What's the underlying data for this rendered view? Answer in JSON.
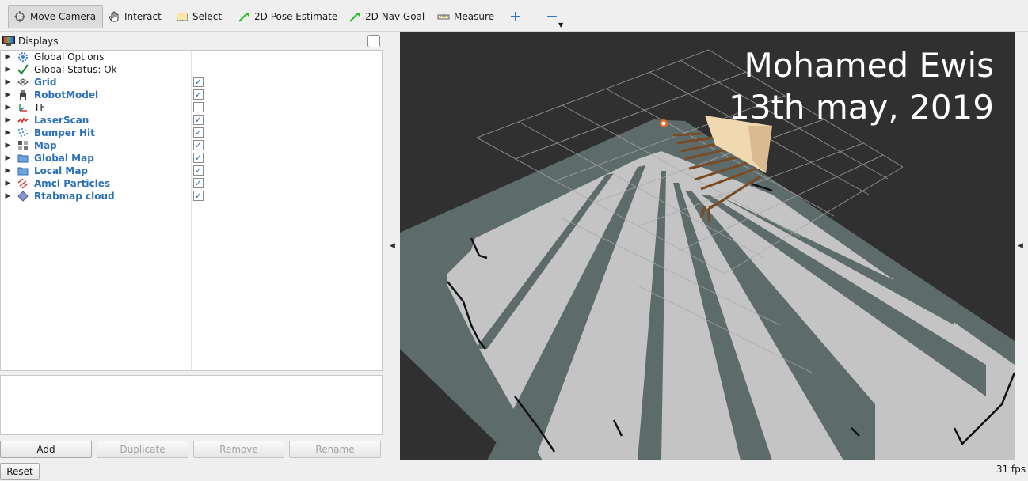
{
  "toolbar": {
    "tools": [
      {
        "label": "Move Camera",
        "icon": "move-camera-icon",
        "active": true
      },
      {
        "label": "Interact",
        "icon": "hand-icon"
      },
      {
        "label": "Select",
        "icon": "select-box-icon"
      },
      {
        "label": "2D Pose Estimate",
        "icon": "green-arrow-icon"
      },
      {
        "label": "2D Nav Goal",
        "icon": "green-arrow-icon"
      },
      {
        "label": "Measure",
        "icon": "ruler-icon"
      }
    ]
  },
  "displays_panel": {
    "title": "Displays",
    "items": [
      {
        "label": "Global Options",
        "icon": "gear-icon",
        "enabled": null
      },
      {
        "label": "Global Status: Ok",
        "icon": "checkmark-icon",
        "enabled": null
      },
      {
        "label": "Grid",
        "icon": "grid-icon",
        "enabled": true
      },
      {
        "label": "RobotModel",
        "icon": "robot-icon",
        "enabled": true
      },
      {
        "label": "TF",
        "icon": "axes-icon",
        "enabled": false
      },
      {
        "label": "LaserScan",
        "icon": "laser-scan-icon",
        "enabled": true
      },
      {
        "label": "Bumper Hit",
        "icon": "point-cloud-icon",
        "enabled": true
      },
      {
        "label": "Map",
        "icon": "map-icon",
        "enabled": true
      },
      {
        "label": "Global Map",
        "icon": "folder-icon",
        "enabled": true
      },
      {
        "label": "Local Map",
        "icon": "folder-icon",
        "enabled": true
      },
      {
        "label": "Amcl Particles",
        "icon": "pose-array-icon",
        "enabled": true
      },
      {
        "label": "Rtabmap cloud",
        "icon": "cloud-icon",
        "enabled": true
      }
    ],
    "buttons": {
      "add": "Add",
      "duplicate": "Duplicate",
      "remove": "Remove",
      "rename": "Rename"
    },
    "reset": "Reset"
  },
  "viewport": {
    "overlay_line1": "Mohamed Ewis",
    "overlay_line2": "13th may, 2019",
    "background_color": "#303030",
    "map_free_color": "#c4c4c4",
    "map_unknown_color": "#5e6b6b",
    "grid_color": "#a8a8a8"
  },
  "status": {
    "fps": "31 fps"
  }
}
